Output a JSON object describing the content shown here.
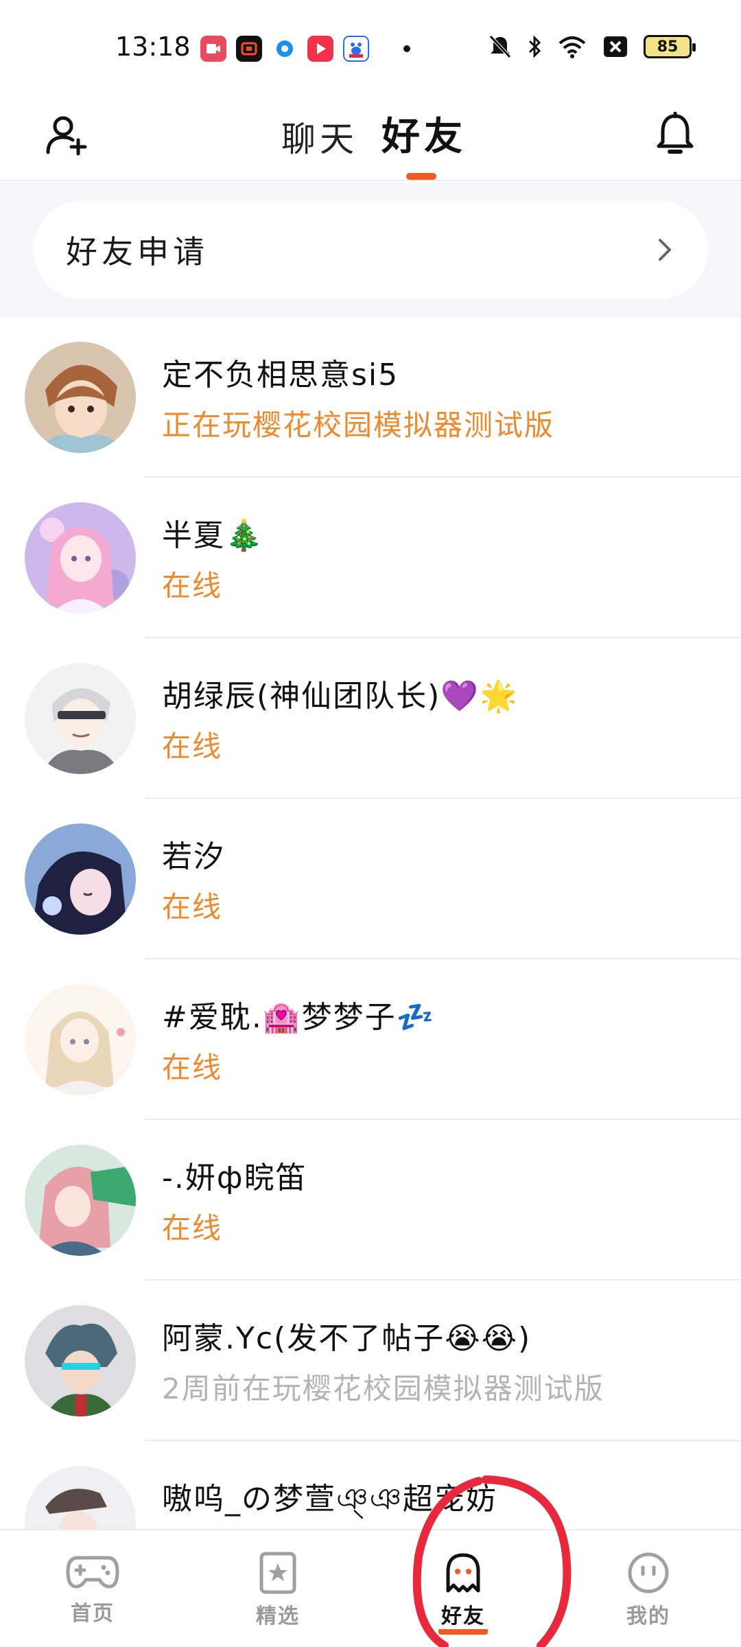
{
  "status_bar": {
    "time": "13:18",
    "battery": "85",
    "app_icons": [
      "video-recorder-icon",
      "screen-record-icon",
      "browser-icon",
      "video-app-icon",
      "baidu-icon"
    ],
    "right_icons": [
      "mute-icon",
      "bluetooth-icon",
      "wifi-icon",
      "sim-off-icon",
      "battery-icon"
    ]
  },
  "header": {
    "tabs": [
      {
        "label": "聊天",
        "active": false
      },
      {
        "label": "好友",
        "active": true
      }
    ],
    "accent_color": "#f05a22"
  },
  "friend_request": {
    "label": "好友申请"
  },
  "friends": [
    {
      "name": "定不负相思意si5",
      "status": "正在玩樱花校园模拟器测试版",
      "online": true
    },
    {
      "name": "半夏🎄",
      "status": "在线",
      "online": true
    },
    {
      "name": "胡绿辰(神仙团队长)💜🌟",
      "status": "在线",
      "online": true
    },
    {
      "name": "若汐",
      "status": "在线",
      "online": true
    },
    {
      "name": "#爱耽.🏩梦梦子💤",
      "status": "在线",
      "online": true
    },
    {
      "name": "-.妍ф睆笛",
      "status": "在线",
      "online": true
    },
    {
      "name": "阿蒙.Yc(发不了帖子😭😭)",
      "status": "2周前在玩樱花校园模拟器测试版",
      "online": false
    },
    {
      "name": "嗷呜_の梦萱ঞ্ঞ超宠妨",
      "status": "",
      "online": false
    }
  ],
  "bottom_nav": [
    {
      "label": "首页",
      "icon": "gamepad-icon",
      "active": false
    },
    {
      "label": "精选",
      "icon": "star-icon",
      "active": false
    },
    {
      "label": "好友",
      "icon": "ghost-icon",
      "active": true
    },
    {
      "label": "我的",
      "icon": "smiley-icon",
      "active": false
    }
  ],
  "colors": {
    "online_status": "#ec8a2e",
    "offline_status": "#b3b3b3",
    "annotation": "#e8283c"
  }
}
